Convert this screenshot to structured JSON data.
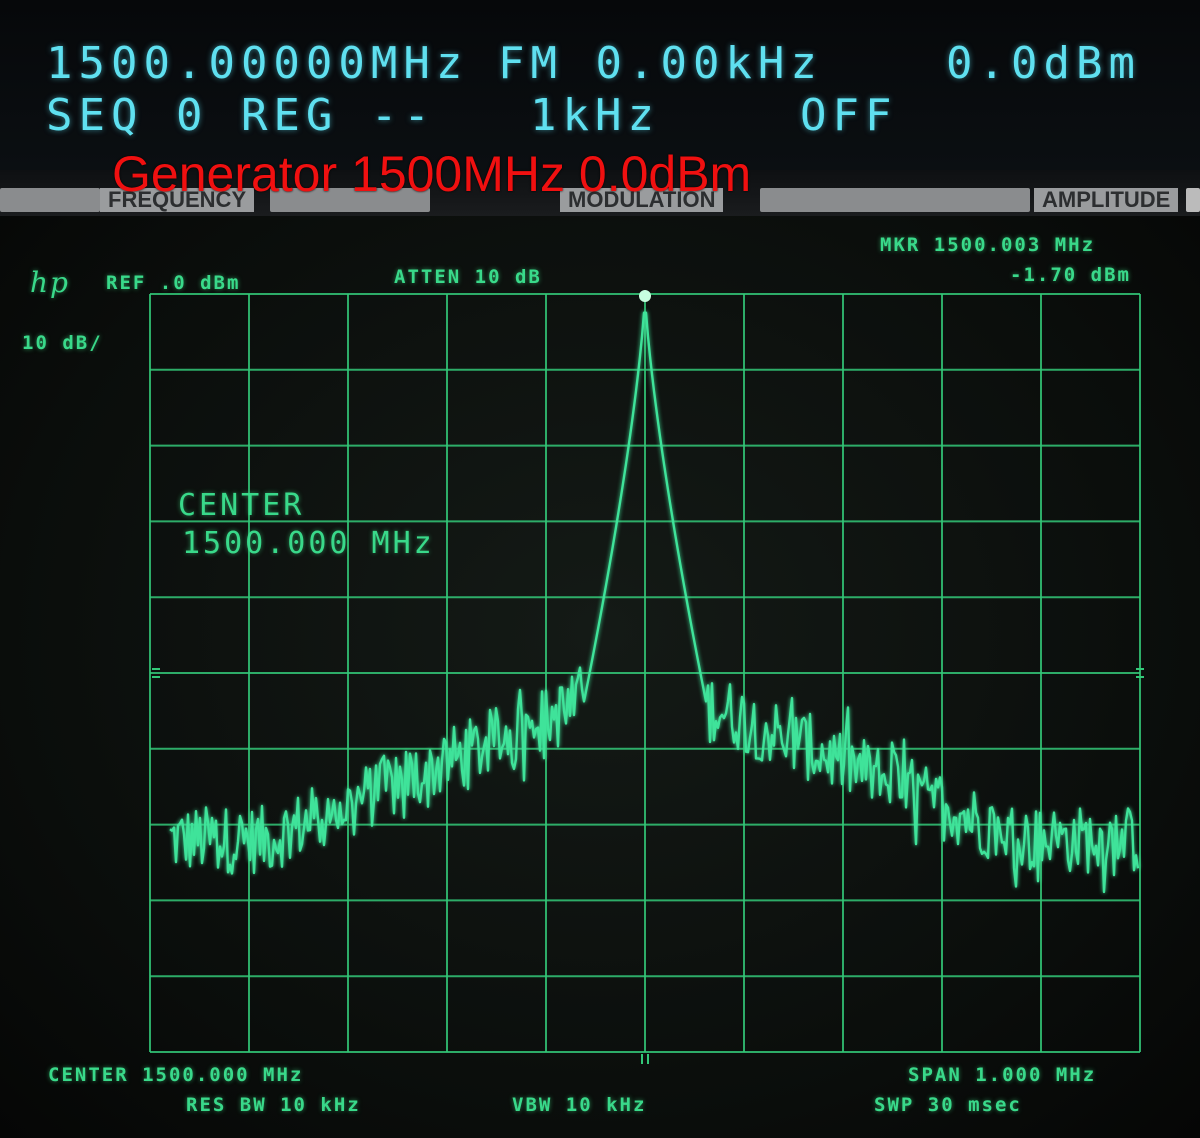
{
  "generator": {
    "frequency": "1500.00000MHz",
    "modulation": "FM 0.00kHz",
    "amplitude": "0.0dBm",
    "sequence": "SEQ 0 REG --",
    "mod_rate": "1kHz",
    "status": "OFF",
    "overlay_label": "Generator 1500MHz 0.0dBm"
  },
  "panel": {
    "frequency_label": "FREQUENCY",
    "modulation_label": "MODULATION",
    "amplitude_label": "AMPLITUDE"
  },
  "analyzer": {
    "logo": "hp",
    "reference": "REF .0 dBm",
    "attenuation": "ATTEN 10 dB",
    "marker_freq": "MKR 1500.003 MHz",
    "marker_level": "-1.70 dBm",
    "scale": "10 dB/",
    "center_annotation_label": "CENTER",
    "center_annotation_value": "1500.000 MHz",
    "center_footer": "CENTER 1500.000 MHz",
    "span": "SPAN 1.000 MHz",
    "res_bw": "RES BW 10 kHz",
    "vbw": "VBW 10 kHz",
    "sweep": "SWP 30 msec"
  },
  "colors": {
    "trace": "#3fe39a",
    "graticule": "#33c878",
    "vfd": "#5fe0f0",
    "overlay": "#f01010"
  }
}
